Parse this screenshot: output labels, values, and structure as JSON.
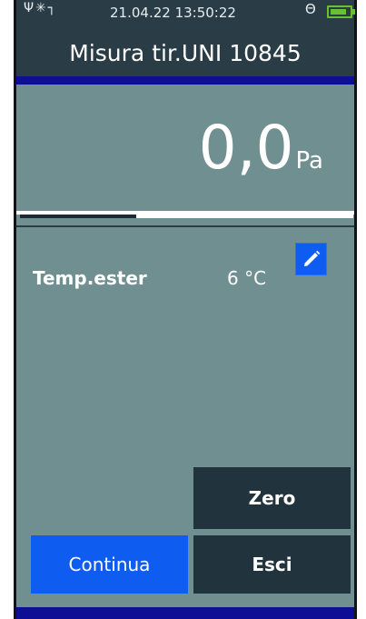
{
  "status_bar": {
    "icons": {
      "usb": "usb-icon",
      "bluetooth": "bluetooth-icon",
      "wrench": "wrench-icon",
      "probe": "probe-icon",
      "battery": "battery-icon"
    },
    "datetime": "21.04.22 13:50:22",
    "battery_level": 0.85
  },
  "header": {
    "title": "Misura tir.UNI 10845"
  },
  "reading": {
    "value": "0,0",
    "unit": "Pa"
  },
  "progress": {
    "fraction": 0.35
  },
  "parameter": {
    "label": "Temp.ester",
    "value": "6 °C",
    "edit_icon": "pencil-icon"
  },
  "buttons": {
    "zero": "Zero",
    "continua": "Continua",
    "esci": "Esci"
  },
  "colors": {
    "background": "#708F91",
    "header": "#2A3D47",
    "stripe": "#0D0D96",
    "primary_button": "#0F5CF0",
    "secondary_button": "#21333D",
    "battery": "#67C232"
  }
}
